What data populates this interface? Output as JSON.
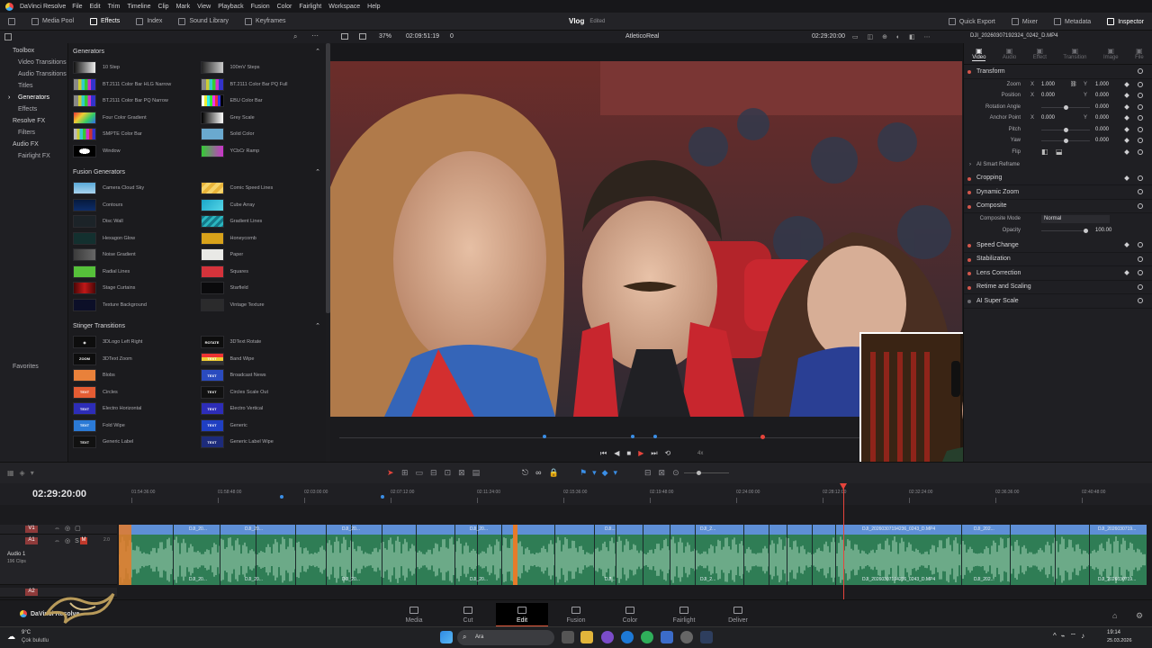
{
  "app": {
    "name": "DaVinci Resolve"
  },
  "menu": [
    "File",
    "Edit",
    "Trim",
    "Timeline",
    "Clip",
    "Mark",
    "View",
    "Playback",
    "Fusion",
    "Color",
    "Fairlight",
    "Workspace",
    "Help"
  ],
  "toolbar": {
    "media_pool": "Media Pool",
    "effects": "Effects",
    "index": "Index",
    "sound_library": "Sound Library",
    "keyframes": "Keyframes",
    "quick_export": "Quick Export",
    "mixer": "Mixer",
    "metadata": "Metadata",
    "inspector": "Inspector"
  },
  "project": {
    "name": "Vlog",
    "status": "Edited"
  },
  "viewer": {
    "zoom": "37%",
    "source_tc": "02:09:51:19",
    "tc_offset": "0",
    "timeline_name": "AtleticoReal",
    "record_tc": "02:29:20:00",
    "clip_name": "DJI_20260307192324_0242_D.MP4"
  },
  "library": {
    "sections": [
      {
        "label": "Toolbox",
        "cls": "sec"
      },
      {
        "label": "Video Transitions",
        "cls": "child"
      },
      {
        "label": "Audio Transitions",
        "cls": "child"
      },
      {
        "label": "Titles",
        "cls": "child"
      },
      {
        "label": "Generators",
        "cls": "child sel"
      },
      {
        "label": "Effects",
        "cls": "child"
      },
      {
        "label": "Resolve FX",
        "cls": "sec"
      },
      {
        "label": "Filters",
        "cls": "child"
      },
      {
        "label": "Audio FX",
        "cls": "sec"
      },
      {
        "label": "Fairlight FX",
        "cls": "child"
      }
    ],
    "favorites": "Favorites"
  },
  "generators": {
    "title": "Generators",
    "items": [
      {
        "name": "10 Step",
        "sw": "linear-gradient(90deg,#111,#eee)"
      },
      {
        "name": "100mV Steps",
        "sw": "linear-gradient(90deg,#222,#ccc)"
      },
      {
        "name": "BT.2111 Color Bar HLG Narrow",
        "sw": "linear-gradient(90deg,#888 0 20%,#cc3 0 35%,#3cc 0 50%,#3c3 0 65%,#c3c 0 80%,#33c 0)"
      },
      {
        "name": "BT.2111 Color Bar PQ Full",
        "sw": "linear-gradient(90deg,#888 0 20%,#cc3 0 35%,#3cc 0 50%,#3c3 0 65%,#c3c 0 80%,#33c 0)"
      },
      {
        "name": "BT.2111 Color Bar PQ Narrow",
        "sw": "linear-gradient(90deg,#888 0 20%,#cc3 0 35%,#3cc 0 50%,#3c3 0 65%,#c3c 0 80%,#33c 0)"
      },
      {
        "name": "EBU Color Bar",
        "sw": "linear-gradient(90deg,#fff 0 12%,#ee3 0 25%,#3ee 0 38%,#3e3 0 50%,#e3e 0 62%,#e33 0 75%,#33e 0 88%,#000 0)"
      },
      {
        "name": "Four Color Gradient",
        "sw": "linear-gradient(135deg,#e33,#ec3,#3c6,#36e)"
      },
      {
        "name": "Grey Scale",
        "sw": "linear-gradient(90deg,#000,#fff)"
      },
      {
        "name": "SMPTE Color Bar",
        "sw": "linear-gradient(90deg,#bbb 0 14%,#cc3 0 28%,#3cc 0 42%,#3c3 0 57%,#c3c 0 71%,#c33 0 85%,#33c 0)"
      },
      {
        "name": "Solid Color",
        "sw": "#6aa9cf"
      },
      {
        "name": "Window",
        "sw": "radial-gradient(#fff 0 35%,#000 0)"
      },
      {
        "name": "YCbCr Ramp",
        "sw": "linear-gradient(90deg,#3c3,#c3c)"
      }
    ]
  },
  "fusion_generators": {
    "title": "Fusion Generators",
    "items": [
      {
        "name": "Camera Cloud Sky",
        "sw": "linear-gradient(#5aa9d8,#a9d4ee)"
      },
      {
        "name": "Comic Speed Lines",
        "sw": "repeating-linear-gradient(135deg,#e8b43a 0 4px,#f5d36a 0 8px)"
      },
      {
        "name": "Contours",
        "sw": "linear-gradient(#061a3e,#0d2d6a)"
      },
      {
        "name": "Cube Array",
        "sw": "linear-gradient(135deg,#1aa6c9,#56d6e6)"
      },
      {
        "name": "Disc Wall",
        "sw": "#1c2328"
      },
      {
        "name": "Gradient Lines",
        "sw": "repeating-linear-gradient(135deg,#157a8a 0 3px,#2bb6bf 0 6px)"
      },
      {
        "name": "Hexagon Glow",
        "sw": "#13302f"
      },
      {
        "name": "Honeycomb",
        "sw": "#d8a21a"
      },
      {
        "name": "Noise Gradient",
        "sw": "linear-gradient(90deg,#3c3c3c,#666)"
      },
      {
        "name": "Paper",
        "sw": "#e9e9e6"
      },
      {
        "name": "Radial Lines",
        "sw": "#56c13a"
      },
      {
        "name": "Squares",
        "sw": "#d5333b"
      },
      {
        "name": "Stage Curtains",
        "sw": "linear-gradient(90deg,#4a0606,#c01818,#4a0606)"
      },
      {
        "name": "Starfield",
        "sw": "#0a0a0c"
      },
      {
        "name": "Texture Background",
        "sw": "#0c0f28"
      },
      {
        "name": "Vintage Texture",
        "sw": "#2b2b2c"
      }
    ]
  },
  "stinger": {
    "title": "Stinger Transitions",
    "items": [
      {
        "name": "3DLogo Left Right",
        "sw": "#0d0d0d",
        "tx": "◉"
      },
      {
        "name": "3DText Rotate",
        "sw": "#0d0d0d",
        "tx": "ROTATE"
      },
      {
        "name": "3DText Zoom",
        "sw": "#0d0d0d",
        "tx": "ZOOM"
      },
      {
        "name": "Band Wipe",
        "sw": "linear-gradient(#e33 0 33%,#ec3 0 66%,#333 0)",
        "tx": "TEXT"
      },
      {
        "name": "Blobs",
        "sw": "#e9813a",
        "tx": ""
      },
      {
        "name": "Broadcast News",
        "sw": "#2a4bbf",
        "tx": "TEXT"
      },
      {
        "name": "Circles",
        "sw": "#e45c33",
        "tx": "TEXT"
      },
      {
        "name": "Circles Scale Out",
        "sw": "#111",
        "tx": "TEXT"
      },
      {
        "name": "Electro Horizontal",
        "sw": "#2d2db8",
        "tx": "TEXT"
      },
      {
        "name": "Electro Vertical",
        "sw": "#2d2db8",
        "tx": "TEXT"
      },
      {
        "name": "Fold Wipe",
        "sw": "#2b7ad6",
        "tx": "TEXT"
      },
      {
        "name": "Generic",
        "sw": "#1f3fc2",
        "tx": "TEXT"
      },
      {
        "name": "Generic Label",
        "sw": "#111",
        "tx": "TEXT"
      },
      {
        "name": "Generic Label Wipe",
        "sw": "#1d2b7a",
        "tx": "TEXT"
      }
    ]
  },
  "inspector": {
    "tabs": [
      "Video",
      "Audio",
      "Effect",
      "Transition",
      "Image",
      "File"
    ],
    "transform": "Transform",
    "params": [
      {
        "label": "Zoom",
        "x": "1.000",
        "y": "1.000",
        "link": true
      },
      {
        "label": "Position",
        "x": "0.000",
        "y": "0.000"
      },
      {
        "label": "Rotation Angle",
        "val": "0.000",
        "kind": "slider",
        "pos": 0.5
      },
      {
        "label": "Anchor Point",
        "x": "0.000",
        "y": "0.000"
      },
      {
        "label": "Pitch",
        "val": "0.000",
        "kind": "slider",
        "pos": 0.5
      },
      {
        "label": "Yaw",
        "val": "0.000",
        "kind": "slider",
        "pos": 0.5
      },
      {
        "label": "Flip",
        "kind": "flip"
      }
    ],
    "smart_reframe": "AI Smart Reframe",
    "sections1": [
      "Cropping",
      "Dynamic Zoom",
      "Composite"
    ],
    "composite_mode_label": "Composite Mode",
    "composite_mode": "Normal",
    "opacity_label": "Opacity",
    "opacity": "100.00",
    "sections2": [
      "Speed Change",
      "Stabilization",
      "Lens Correction",
      "Retime and Scaling",
      "AI Super Scale"
    ]
  },
  "timeline": {
    "timecode": "02:29:20:00",
    "ruler": [
      "01:54:36:00",
      "01:58:48:00",
      "02:03:00:00",
      "02:07:12:00",
      "02:11:24:00",
      "02:15:36:00",
      "02:19:48:00",
      "02:24:00:00",
      "02:28:12:00",
      "02:32:24:00",
      "02:36:36:00",
      "02:40:48:00"
    ],
    "tracks": {
      "v1": "V1",
      "a1": "A1",
      "a1_name": "Audio 1",
      "a1_clips": "196 Clips",
      "a1_level": "2.0",
      "a2": "A2"
    },
    "clip_labels": [
      "DJI_20...",
      "DJI_20...",
      "DJI_20...",
      "DJI_20...",
      "DJI...",
      "DJI_2...",
      "DJI_20260307194236_0243_D.MP4",
      "DJI_202...",
      "DJI_2026030719..."
    ]
  },
  "pages": [
    {
      "label": "Media"
    },
    {
      "label": "Cut"
    },
    {
      "label": "Edit",
      "on": true
    },
    {
      "label": "Fusion"
    },
    {
      "label": "Color"
    },
    {
      "label": "Fairlight"
    },
    {
      "label": "Deliver"
    }
  ],
  "brand": "DaVinci Resolve",
  "taskbar": {
    "weather_temp": "9°C",
    "weather_desc": "Çok bulutlu",
    "search": "Ara",
    "time": "19:14",
    "date": "25.03.2026"
  }
}
